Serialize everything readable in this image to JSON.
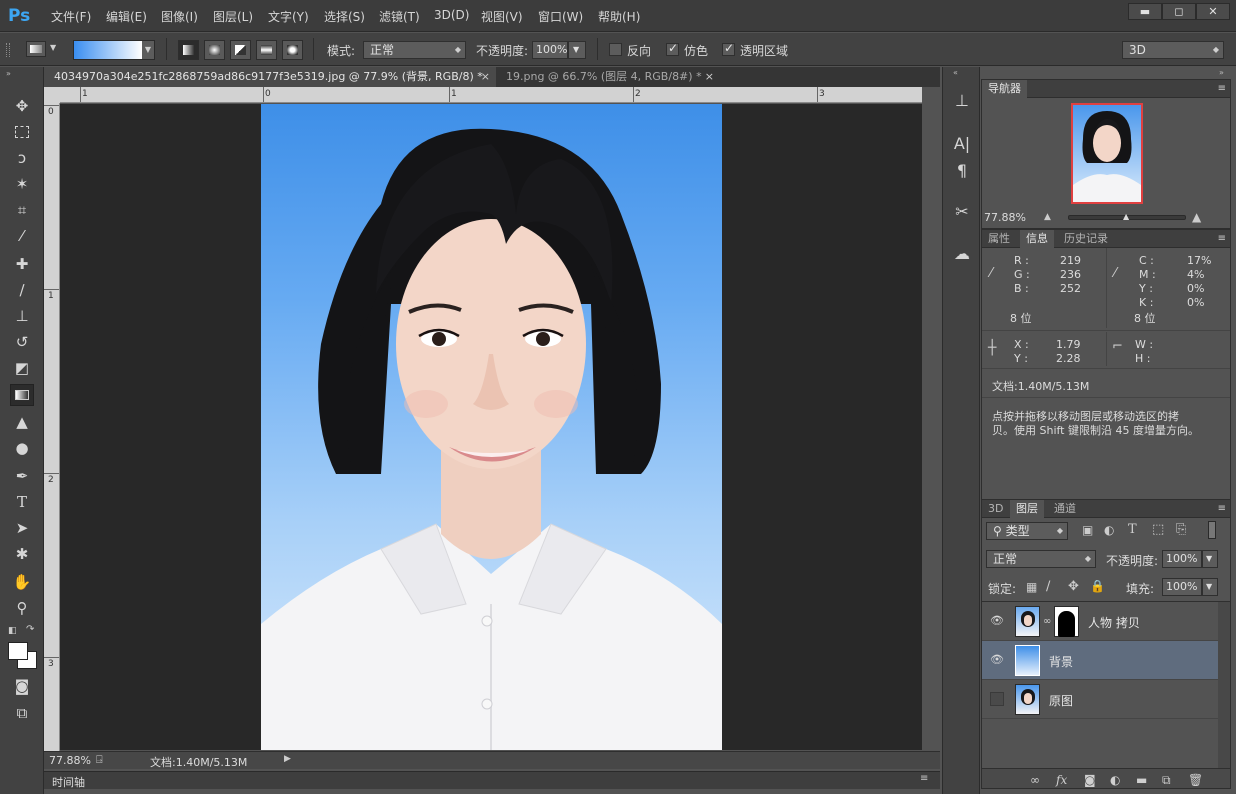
{
  "app": {
    "logo": "Ps",
    "menu": [
      "文件(F)",
      "编辑(E)",
      "图像(I)",
      "图层(L)",
      "文字(Y)",
      "选择(S)",
      "滤镜(T)",
      "3D(D)",
      "视图(V)",
      "窗口(W)",
      "帮助(H)"
    ],
    "window_buttons": {
      "minimize": "▬",
      "maximize": "◻",
      "close": "✕"
    }
  },
  "options": {
    "mode_label": "模式:",
    "mode_value": "正常",
    "opacity_label": "不透明度:",
    "opacity_value": "100%",
    "reverse_label": "反向",
    "dither_label": "仿色",
    "transparency_label": "透明区域",
    "workspace_value": "3D",
    "reverse_checked": false,
    "dither_checked": true,
    "transparency_checked": true,
    "gradient_colors": [
      "#3a8ef0",
      "#ffffff"
    ]
  },
  "tabs": [
    {
      "label": "4034970a304e251fc2868759ad86c9177f3e5319.jpg @ 77.9% (背景, RGB/8) *",
      "close": "×"
    },
    {
      "label": "19.png @ 66.7% (图层 4, RGB/8#) *",
      "close": "×"
    }
  ],
  "rulers": {
    "top": [
      "1",
      "0",
      "1",
      "2",
      "3"
    ],
    "left": [
      "0",
      "1",
      "2",
      "3"
    ]
  },
  "status": {
    "zoom": "77.88%",
    "doc": "文档:1.40M/5.13M",
    "timeline": "时间轴"
  },
  "navigator": {
    "tab": "导航器",
    "zoom": "77.88%"
  },
  "info": {
    "tabs": [
      "属性",
      "信息",
      "历史记录"
    ],
    "R_label": "R :",
    "R": "219",
    "G_label": "G :",
    "G": "236",
    "B_label": "B :",
    "B": "252",
    "bits1": "8 位",
    "C_label": "C :",
    "C": "17%",
    "M_label": "M :",
    "M": "4%",
    "Y_label": "Y :",
    "Y": "0%",
    "K_label": "K :",
    "K": "0%",
    "bits2": "8 位",
    "X_label": "X :",
    "X": "1.79",
    "Yc_label": "Y :",
    "Yc": "2.28",
    "W_label": "W :",
    "H_label": "H :",
    "doc": "文档:1.40M/5.13M",
    "hint_line1": "点按并拖移以移动图层或移动选区的拷",
    "hint_line2": "贝。使用 Shift 键限制沿 45 度增量方向。"
  },
  "layers": {
    "tabs": [
      "3D",
      "图层",
      "通道"
    ],
    "filter": "类型",
    "blend": "正常",
    "opacity_label": "不透明度:",
    "opacity": "100%",
    "lock_label": "锁定:",
    "fill_label": "填充:",
    "fill": "100%",
    "items": [
      {
        "name": "人物 拷贝",
        "visible": true,
        "selected": false
      },
      {
        "name": "背景",
        "visible": true,
        "selected": true
      },
      {
        "name": "原图",
        "visible": false,
        "selected": false
      }
    ]
  },
  "colors": {
    "accent": "#3da6f2",
    "selected_layer": "#5f6c7e",
    "nav_frame": "#e04040"
  }
}
